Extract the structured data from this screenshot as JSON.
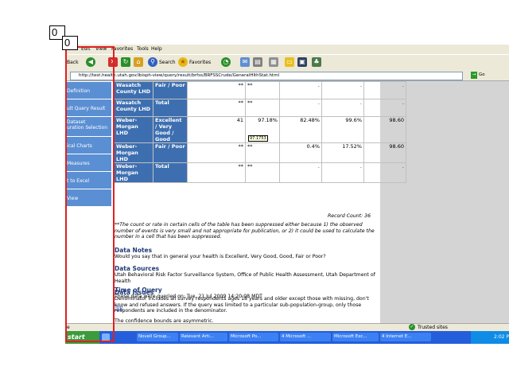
{
  "badges": [
    "0",
    "0"
  ],
  "menu": [
    "Edit",
    "View",
    "Favorites",
    "Tools",
    "Help"
  ],
  "toolbar": {
    "back": "Back",
    "search": "Search",
    "favorites": "Favorites"
  },
  "address": {
    "url": "http://test.health.utah.gov/ibisph-view/query/result/brfss/BRFSSCrude/GeneralHlthStat.html",
    "go": "Go"
  },
  "sidebar": [
    "Definition",
    "ult Query Result",
    "Dataset\nuration Selection",
    "ical Charts",
    "Measures",
    "t to Excel",
    "View"
  ],
  "table_rows": [
    {
      "county": "Wasatch County LHD",
      "response": "Fair / Poor",
      "n": "**",
      "pct": "**",
      "lower": ".",
      "upper": ".",
      "c5": "."
    },
    {
      "county": "Wasatch County LHD",
      "response": "Total",
      "n": "**",
      "pct": "**",
      "lower": ".",
      "upper": ".",
      "c5": "."
    },
    {
      "county": "Weber-Morgan LHD",
      "response": "Excellent / Very Good / Good",
      "n": "41",
      "pct": "97.18%",
      "lower": "82.48%",
      "upper": "99.6%",
      "c5": "98.60"
    },
    {
      "county": "Weber-Morgan LHD",
      "response": "Fair / Poor",
      "n": "**",
      "pct": "**",
      "lower": "0.4%",
      "upper": "17.52%",
      "c5": "98.60"
    },
    {
      "county": "Weber-Morgan LHD",
      "response": "Total",
      "n": "**",
      "pct": "**",
      "lower": ".",
      "upper": ".",
      "c5": "."
    }
  ],
  "tooltip": "97.1753",
  "record_count": "Record Count: 36",
  "footnote": "**The count or rate in certain cells of the table has been suppressed either because 1) the observed number of events is very small and not appropriate for publication, or 2) it could be used to calculate the number in a cell that has been suppressed.",
  "data_notes": {
    "title": "Data Notes",
    "text": "Would you say that in general your health is Excellent, Very Good, Good, Fair or Poor?"
  },
  "data_sources": {
    "title": "Data Sources",
    "text": "Utah Behavioral Risk Factor Surveillance System, Office of Public Health Assessment, Utah Department of Health"
  },
  "data_issues": {
    "title": "Data Issues",
    "text": "Denominator includes all survey respondents ages 18 years and older except those with missing, don't know and refused answers. If the query was limited to a particular sub-population-group, only those respondents are included in the denominator.",
    "text2": "The confidence bounds are asymmetric."
  },
  "time_of_query": {
    "title": "Time of Query",
    "text": "These data were queried on: Tue, 21 Jul 2009 14:20:08 MDT"
  },
  "top_link": "Top",
  "status": {
    "left": "e",
    "right": "Trusted sites"
  },
  "taskbar": {
    "start": "start",
    "tasks": [
      "Novell Group...",
      "Relevant Arti...",
      "Microsoft Po...",
      "4 Microsoft ...",
      "Microsoft Exc...",
      "4 Internet E..."
    ],
    "clock": "2:02 P"
  }
}
